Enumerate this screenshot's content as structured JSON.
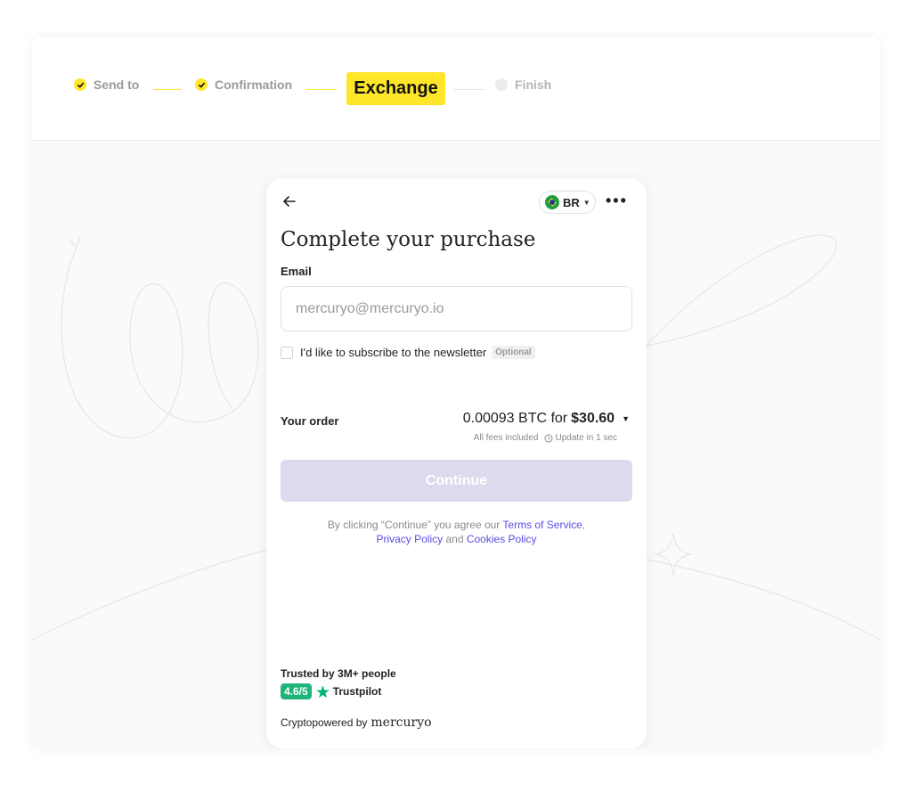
{
  "stepper": {
    "step1": "Send to",
    "step2": "Confirmation",
    "step3": "Exchange",
    "step4": "Finish"
  },
  "widget": {
    "country": "BR",
    "title": "Complete your purchase",
    "email_label": "Email",
    "email_placeholder": "mercuryo@mercuryo.io",
    "newsletter_label": "I'd like to subscribe to the newsletter",
    "optional_badge": "Optional",
    "order_label": "Your order",
    "order_crypto": "0.00093 BTC for",
    "order_fiat": "$30.60",
    "fees_text": "All fees included",
    "update_text": "Update in 1 sec",
    "continue_label": "Continue",
    "legal_prefix": "By clicking “Continue” you agree our",
    "terms_link": "Terms of Service",
    "privacy_link": "Privacy Policy",
    "and_text": "and",
    "cookies_link": "Cookies Policy",
    "trusted_text": "Trusted by 3M+ people",
    "rating": "4.6/5",
    "trustpilot": "Trustpilot",
    "powered_prefix": "Cryptopowered by",
    "brand": "mercuryo"
  },
  "colors": {
    "accent_yellow": "#ffe629",
    "link_purple": "#5b4de0",
    "button_disabled": "#dcdaec",
    "trustpilot_green": "#1fb47a"
  }
}
